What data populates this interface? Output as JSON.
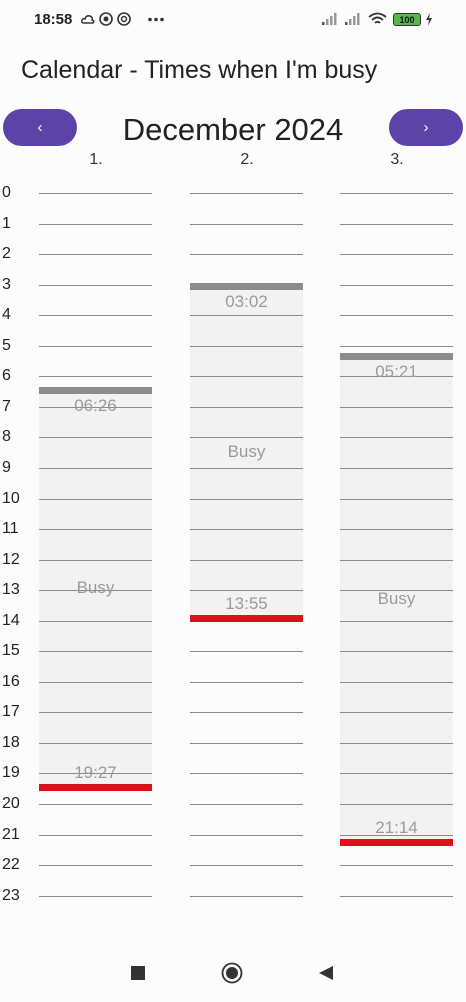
{
  "status": {
    "time": "18:58",
    "battery": "100",
    "icons": [
      "cloud-icon",
      "mastodon-icon",
      "threads-icon",
      "more-dots-icon",
      "signal-1-icon",
      "signal-2-icon",
      "wifi-icon",
      "battery-icon",
      "charging-icon"
    ]
  },
  "app": {
    "title": "Calendar - Times when I'm busy"
  },
  "nav": {
    "prev_label": "‹",
    "next_label": "›",
    "month": "December 2024"
  },
  "days": [
    "1.",
    "2.",
    "3."
  ],
  "hours": [
    "0",
    "1",
    "2",
    "3",
    "4",
    "5",
    "6",
    "7",
    "8",
    "9",
    "10",
    "11",
    "12",
    "13",
    "14",
    "15",
    "16",
    "17",
    "18",
    "19",
    "20",
    "21",
    "22",
    "23"
  ],
  "busy": [
    {
      "day": "1.",
      "start": "06:26",
      "end": "19:27",
      "label": "Busy"
    },
    {
      "day": "2.",
      "start": "03:02",
      "end": "13:55",
      "label": "Busy"
    },
    {
      "day": "3.",
      "start": "05:21",
      "end": "21:14",
      "label": "Busy"
    }
  ],
  "colors": {
    "accent": "#5c43a8",
    "end_marker": "#e0101b",
    "start_marker": "#8c8c8c"
  },
  "system_nav": [
    "stop-square-icon",
    "home-circle-icon",
    "back-triangle-icon"
  ]
}
